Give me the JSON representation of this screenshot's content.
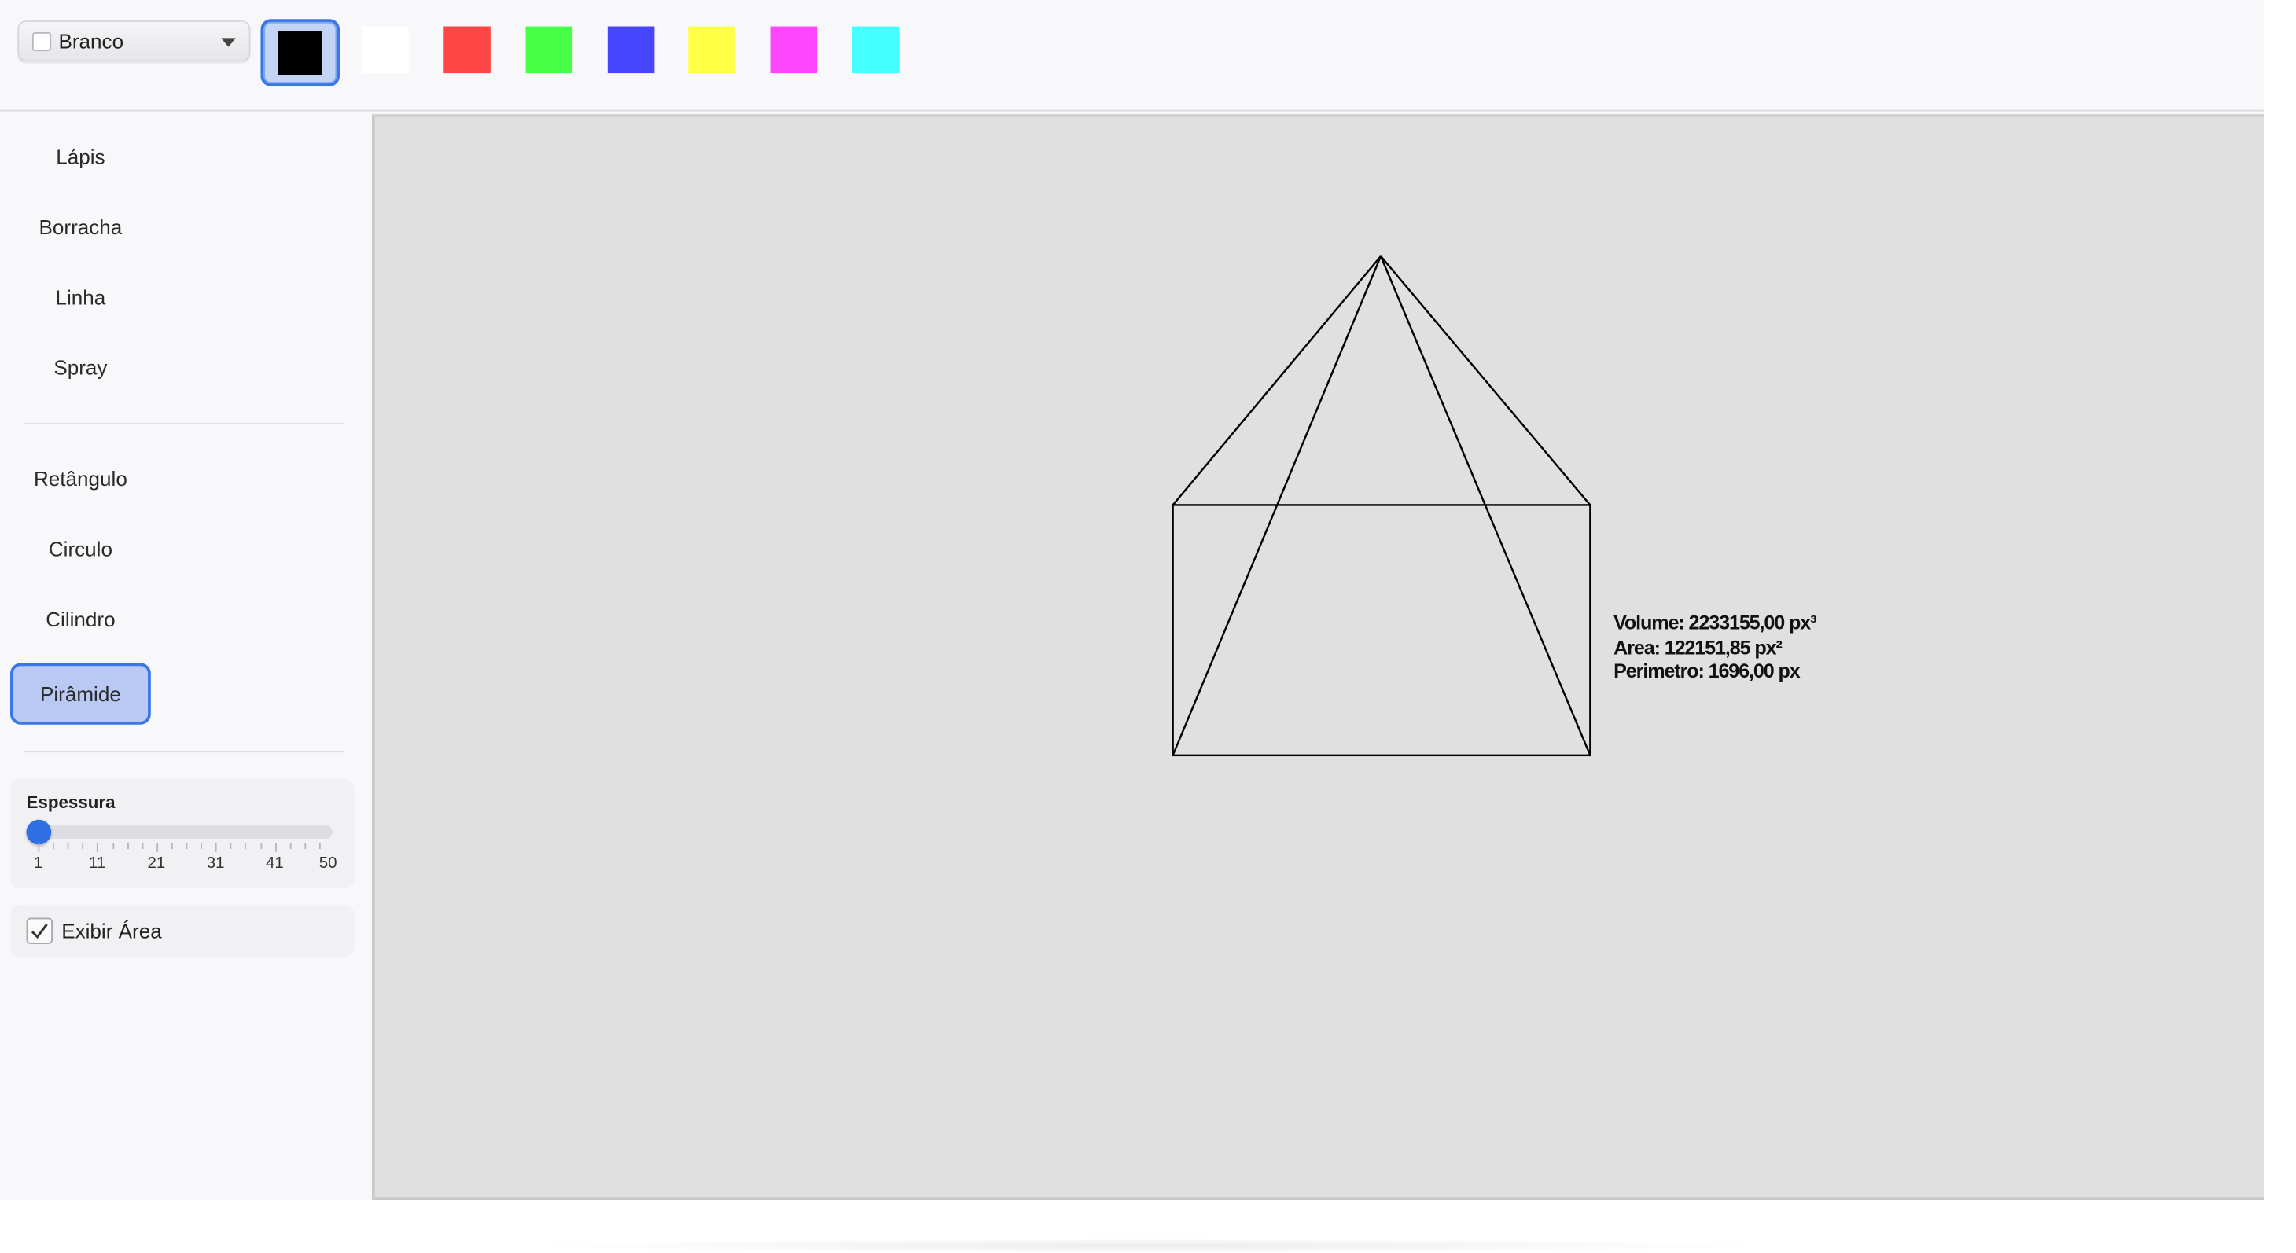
{
  "toolbar": {
    "color_select": {
      "selected_label": "Branco",
      "chip_icon": "white-square-icon",
      "caret_icon": "chevron-down-icon"
    },
    "swatches": [
      {
        "name": "black",
        "color": "#000000",
        "selected": true
      },
      {
        "name": "white",
        "color": "#ffffff",
        "selected": false
      },
      {
        "name": "red",
        "color": "#ff4646",
        "selected": false
      },
      {
        "name": "green",
        "color": "#46ff46",
        "selected": false
      },
      {
        "name": "blue",
        "color": "#4646ff",
        "selected": false
      },
      {
        "name": "yellow",
        "color": "#ffff46",
        "selected": false
      },
      {
        "name": "magenta",
        "color": "#ff46ff",
        "selected": false
      },
      {
        "name": "cyan",
        "color": "#46ffff",
        "selected": false
      }
    ]
  },
  "sidebar": {
    "tools": [
      {
        "label": "Lápis",
        "active": false
      },
      {
        "label": "Borracha",
        "active": false
      },
      {
        "label": "Linha",
        "active": false
      },
      {
        "label": "Spray",
        "active": false
      },
      {
        "label": "Retângulo",
        "active": false
      },
      {
        "label": "Circulo",
        "active": false
      },
      {
        "label": "Cilindro",
        "active": false
      },
      {
        "label": "Pirâmide",
        "active": true
      }
    ],
    "thickness": {
      "title": "Espessura",
      "value": 1,
      "min": 1,
      "max": 50,
      "tick_labels": [
        "1",
        "11",
        "21",
        "31",
        "41",
        "50"
      ]
    },
    "show_area": {
      "label": "Exibir Área",
      "checked": true
    }
  },
  "canvas": {
    "background": "#e0e0e0",
    "stroke_color": "#000000",
    "measurements": {
      "volume": "Volume: 2233155,00 px³",
      "area": "Area: 122151,85 px²",
      "perimeter": "Perimetro: 1696,00 px"
    }
  },
  "colors": {
    "accent": "#3a76e6",
    "accent_light": "#b9c9f3"
  }
}
